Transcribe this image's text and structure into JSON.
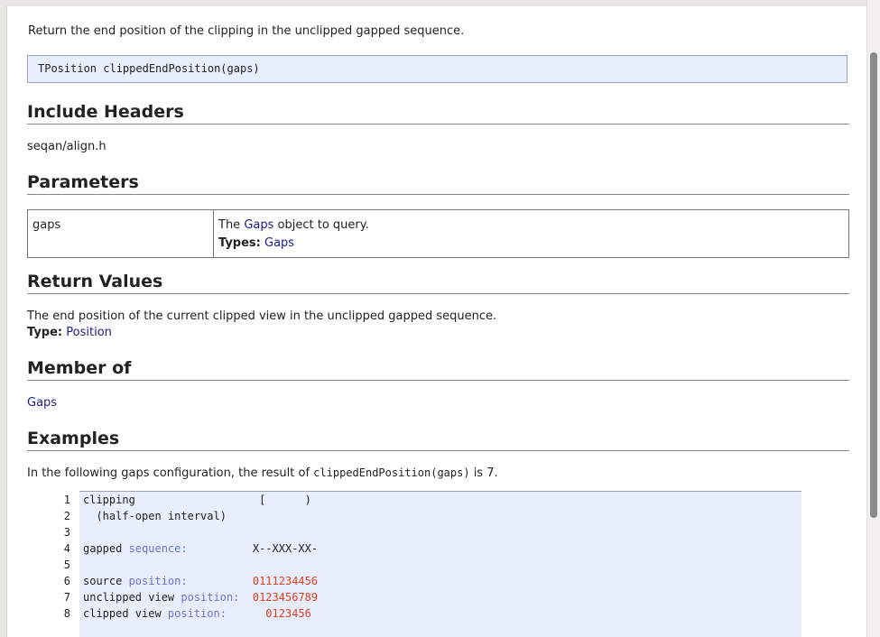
{
  "intro": "Return the end position of the clipping in the unclipped gapped sequence.",
  "signature": "TPosition clippedEndPosition(gaps)",
  "sections": {
    "include": {
      "heading": "Include Headers",
      "text": "seqan/align.h"
    },
    "parameters": {
      "heading": "Parameters",
      "rows": [
        {
          "name": "gaps",
          "desc_pre": "The ",
          "desc_link": "Gaps",
          "desc_post": " object to query.",
          "types_label": "Types:",
          "types_link": "Gaps"
        }
      ]
    },
    "returns": {
      "heading": "Return Values",
      "text": "The end position of the current clipped view in the unclipped gapped sequence.",
      "type_label": "Type:",
      "type_link": "Position"
    },
    "member_of": {
      "heading": "Member of",
      "link": "Gaps"
    },
    "examples": {
      "heading": "Examples",
      "text_pre": "In the following gaps configuration, the result of ",
      "text_code": "clippedEndPosition(gaps)",
      "text_post": " is 7."
    }
  },
  "code": {
    "line_numbers": [
      "1",
      "2",
      "3",
      "4",
      "5",
      "6",
      "7",
      "8"
    ],
    "lines": [
      {
        "a": "clipping                   [      )",
        "b": "",
        "c": "",
        "d": ""
      },
      {
        "a": "  (half-open interval)",
        "b": "",
        "c": "",
        "d": ""
      },
      {
        "a": "",
        "b": "",
        "c": "",
        "d": ""
      },
      {
        "a": "gapped ",
        "b": "sequence:",
        "c": "          X--XXX-XX-",
        "d": ""
      },
      {
        "a": "",
        "b": "",
        "c": "",
        "d": ""
      },
      {
        "a": "source ",
        "b": "position:",
        "c": "          ",
        "d": "0111234456"
      },
      {
        "a": "unclipped view ",
        "b": "position:",
        "c": "  ",
        "d": "0123456789"
      },
      {
        "a": "clipped view ",
        "b": "position:",
        "c": "     ",
        "d": " 0123456"
      }
    ]
  },
  "colors": {
    "link": "#1a1a8c",
    "keyword": "#6a74d8",
    "number": "#e0401a",
    "code_bg": "#e8eefe"
  }
}
